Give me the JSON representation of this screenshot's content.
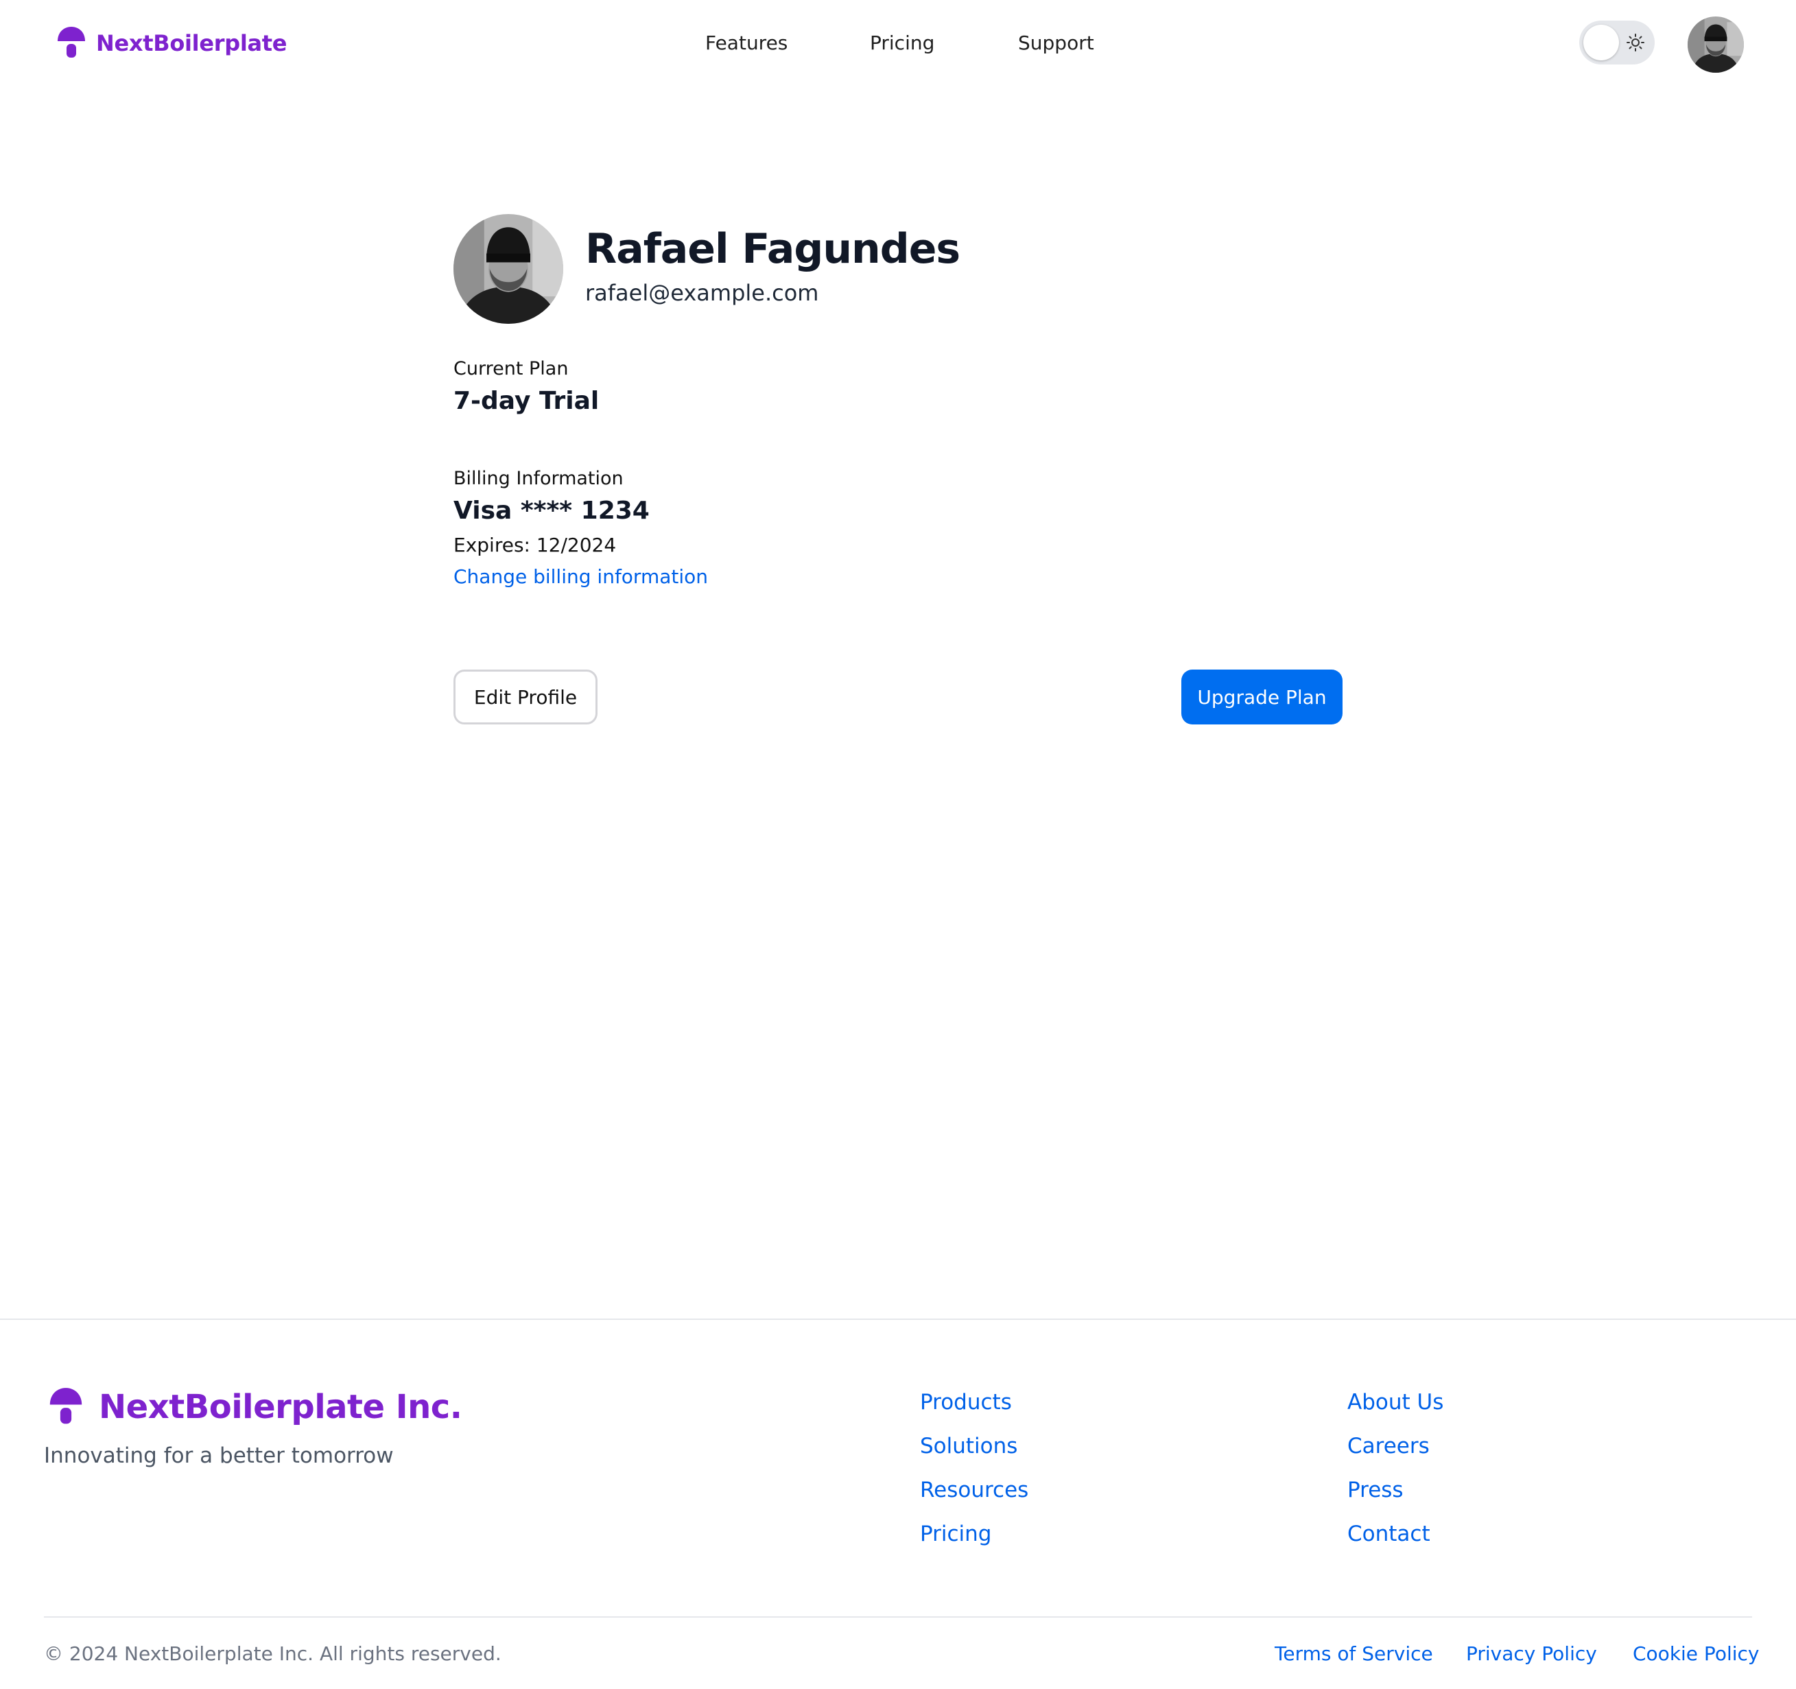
{
  "header": {
    "brand": "NextBoilerplate",
    "nav": [
      "Features",
      "Pricing",
      "Support"
    ],
    "theme_toggle": {
      "mode": "light",
      "icon": "sun-icon"
    }
  },
  "profile": {
    "name": "Rafael Fagundes",
    "email": "rafael@example.com"
  },
  "plan": {
    "label": "Current Plan",
    "value": "7-day Trial"
  },
  "billing": {
    "label": "Billing Information",
    "card": "Visa **** 1234",
    "expires": "Expires: 12/2024",
    "change_link": "Change billing information"
  },
  "actions": {
    "edit": "Edit Profile",
    "upgrade": "Upgrade Plan"
  },
  "footer": {
    "brand": "NextBoilerplate Inc.",
    "tagline": "Innovating for a better tomorrow",
    "col1": [
      "Products",
      "Solutions",
      "Resources",
      "Pricing"
    ],
    "col2": [
      "About Us",
      "Careers",
      "Press",
      "Contact"
    ],
    "copyright": "© 2024 NextBoilerplate Inc. All rights reserved.",
    "legal": [
      "Terms of Service",
      "Privacy Policy",
      "Cookie Policy"
    ]
  },
  "colors": {
    "brand": "#7e22ce",
    "link": "#0061e8",
    "primary_button": "#006ef0"
  }
}
